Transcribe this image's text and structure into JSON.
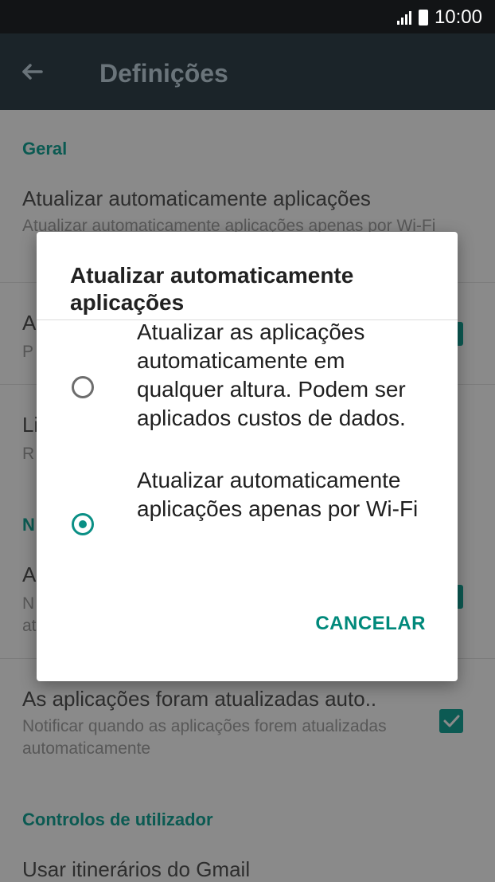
{
  "status_bar": {
    "time": "10:00",
    "icons": [
      "signal-icon",
      "battery-icon"
    ]
  },
  "app_bar": {
    "title": "Definições",
    "back_icon": "arrow-left-icon"
  },
  "settings": {
    "section_general": "Geral",
    "auto_update_title": "Atualizar automaticamente aplicações",
    "auto_update_sub": "Atualizar automaticamente aplicações apenas por Wi-Fi",
    "partial_1_title": "A",
    "partial_1_sub": "P",
    "partial_2_title": "Li",
    "partial_2_sub": "R",
    "partial_n": "N",
    "partial_3_title": "A",
    "partial_3_sub_1": "N",
    "partial_3_sub_2": "at",
    "auto_updated_title": "As aplicações foram atualizadas auto..",
    "auto_updated_sub": "Notificar quando as aplicações forem atualizadas automaticamente",
    "section_user_controls": "Controlos de utilizador",
    "gmail_itineraries": "Usar itinerários do Gmail"
  },
  "dialog": {
    "title": "Atualizar automaticamente aplicações",
    "options": [
      {
        "label": "Atualizar as aplicações automaticamente em qualquer altura. Podem ser aplicados custos de dados.",
        "selected": false
      },
      {
        "label": "Atualizar automaticamente aplicações apenas por Wi-Fi",
        "selected": true
      }
    ],
    "cancel_label": "CANCELAR"
  },
  "colors": {
    "accent": "#00897b",
    "status_bar_bg": "#121416",
    "app_bar_bg": "#1b2429",
    "overlay_bg": "#8a8a8a"
  }
}
